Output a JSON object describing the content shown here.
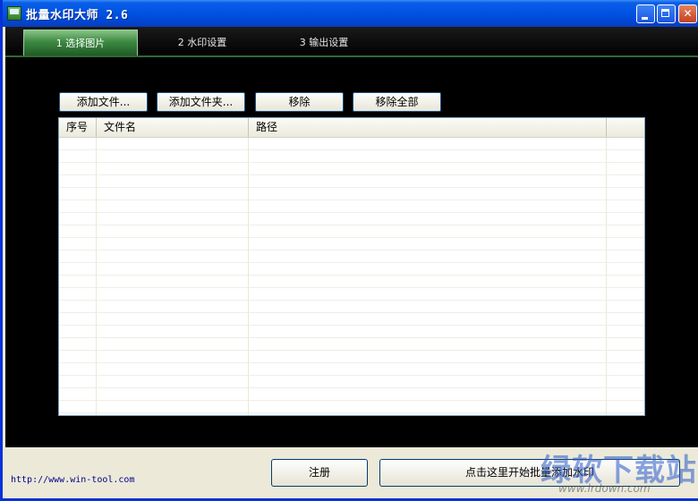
{
  "window": {
    "title": "批量水印大师 2.6"
  },
  "tabs": [
    {
      "label": "1 选择图片",
      "active": true
    },
    {
      "label": "2 水印设置",
      "active": false
    },
    {
      "label": "3 输出设置",
      "active": false
    }
  ],
  "toolbar": {
    "add_files": "添加文件...",
    "add_folder": "添加文件夹...",
    "remove": "移除",
    "remove_all": "移除全部"
  },
  "table": {
    "columns": [
      "序号",
      "文件名",
      "路径",
      ""
    ],
    "rows": []
  },
  "footer": {
    "url": "http://www.win-tool.com",
    "register_label": "注册",
    "start_label": "点击这里开始批量添加水印"
  },
  "overlay_watermark": {
    "text": "绿软下载站",
    "sub": "www.lrdown.com"
  },
  "colors": {
    "titlebar": "#0054e3",
    "client_bg": "#000000",
    "active_tab": "#3e8a42",
    "panel": "#ece9d8"
  }
}
